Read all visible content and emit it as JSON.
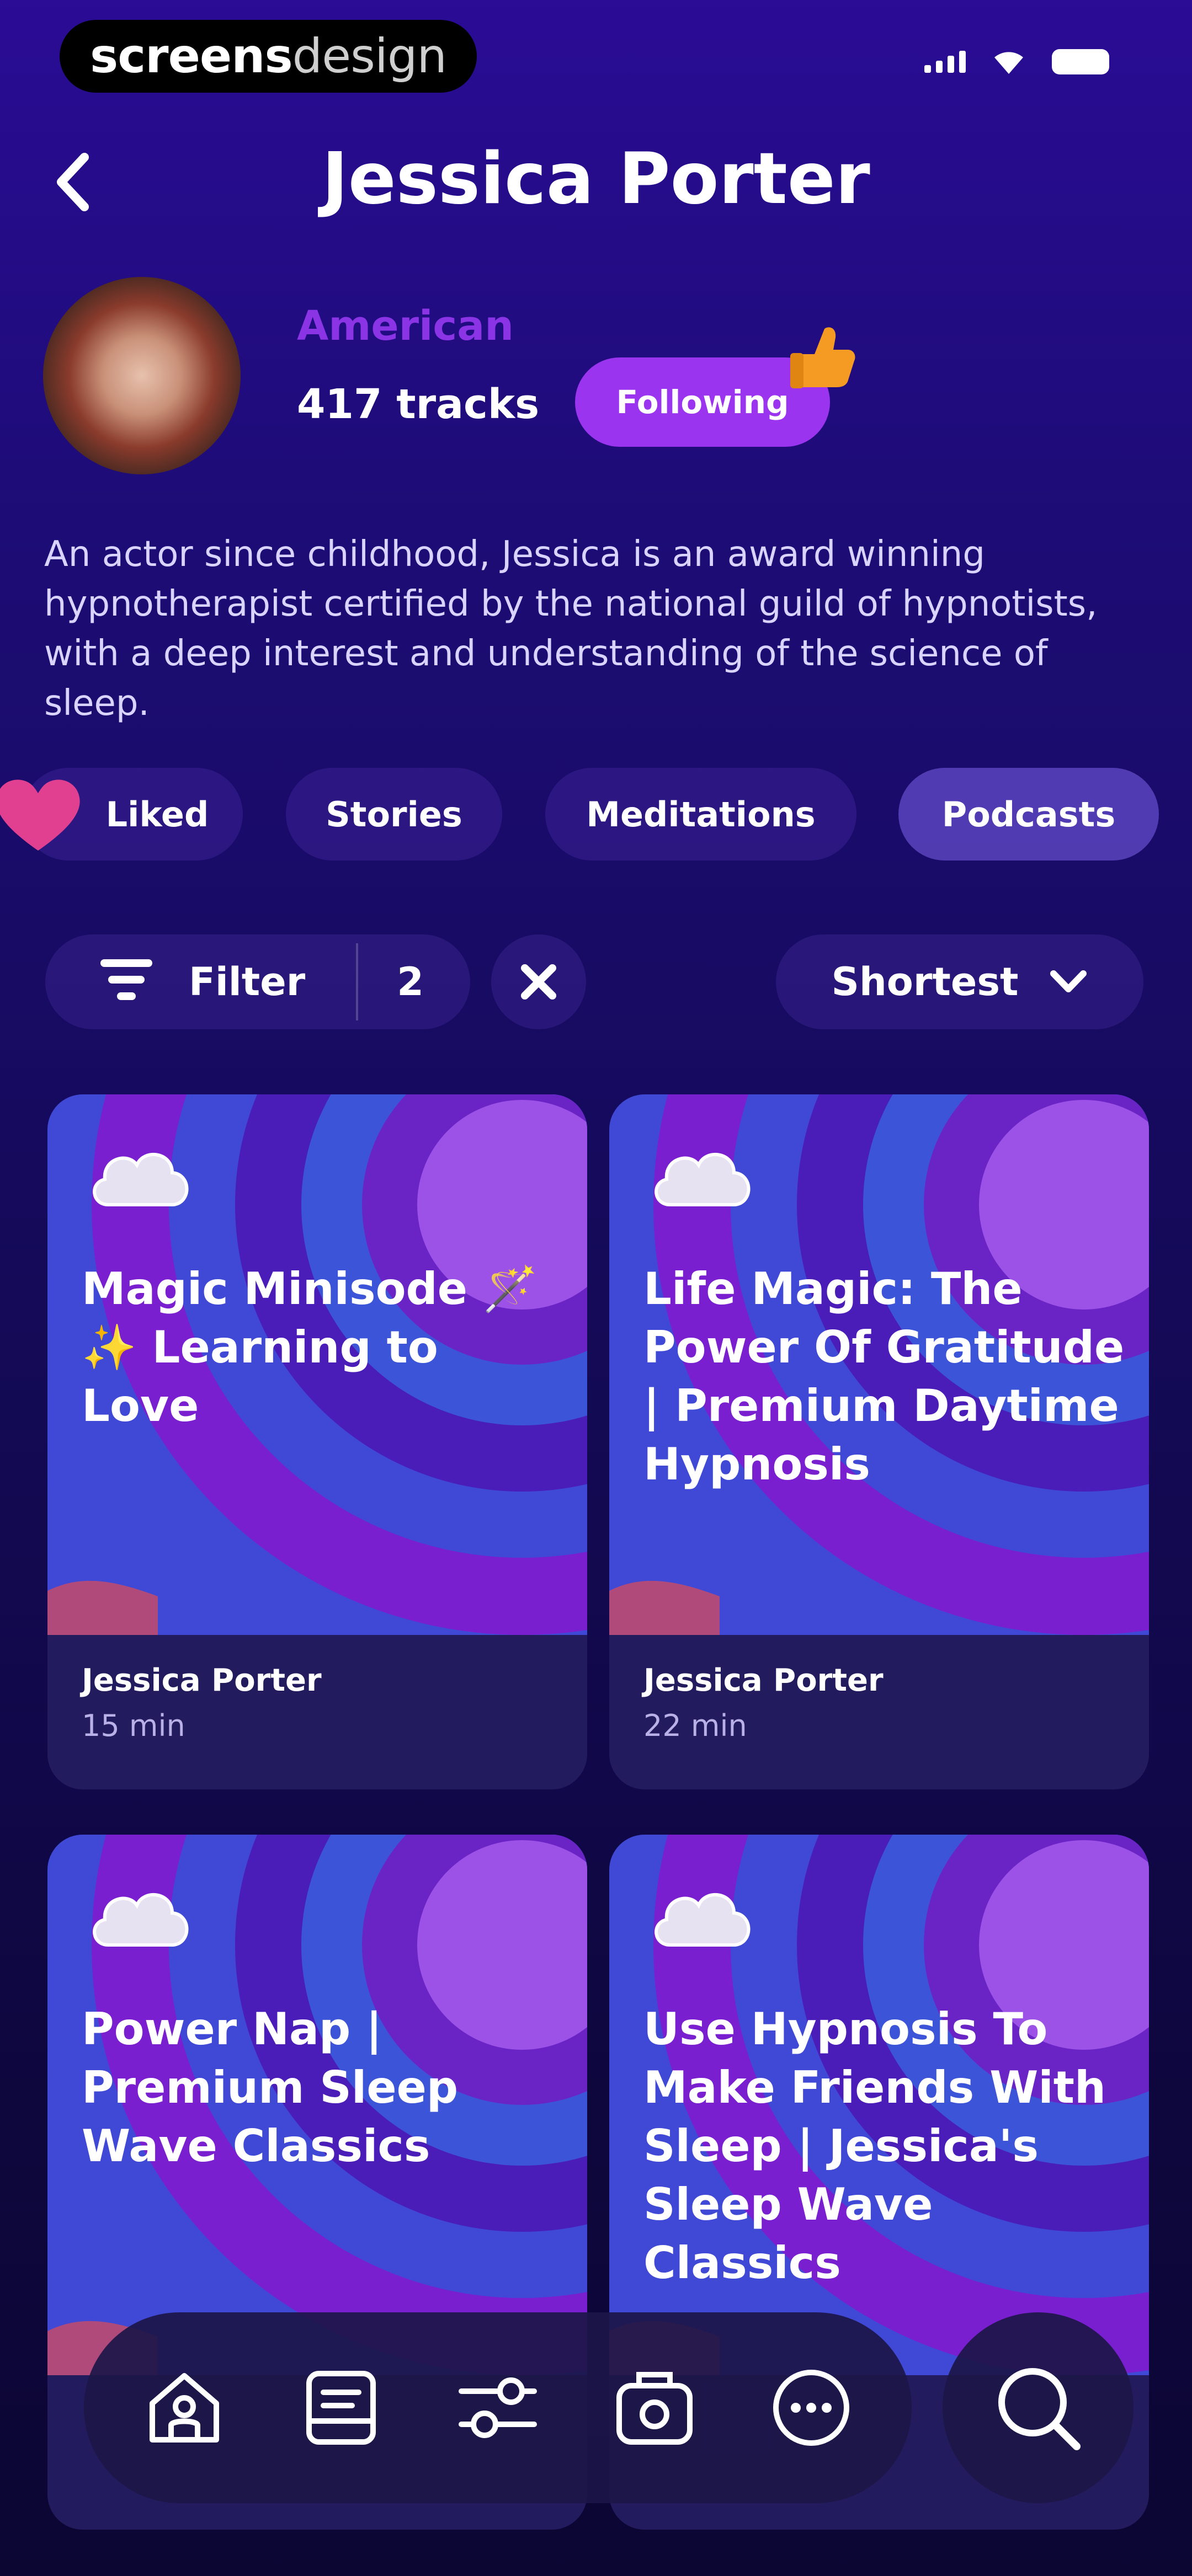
{
  "status_bar": {
    "brand_part1": "screens",
    "brand_part2": "design"
  },
  "header": {
    "title": "Jessica Porter"
  },
  "profile": {
    "nationality": "American",
    "tracks": "417 tracks",
    "follow_label": "Following",
    "bio": "An actor since childhood, Jessica is an award winning hypnotherapist certified by the national guild of hypnotists, with a deep interest and understanding of the science of sleep."
  },
  "categories": [
    {
      "label": "Liked",
      "icon": "heart-icon",
      "active": false
    },
    {
      "label": "Stories",
      "active": false
    },
    {
      "label": "Meditations",
      "active": false
    },
    {
      "label": "Podcasts",
      "active": true
    }
  ],
  "filter": {
    "label": "Filter",
    "count": "2",
    "sort_label": "Shortest"
  },
  "cards": [
    {
      "title": "Magic Minisode 🪄 ✨ Learning to Love",
      "author": "Jessica Porter",
      "duration": "15 min"
    },
    {
      "title": "Life Magic: The Power Of Gratitude | Premium Daytime Hypnosis",
      "author": "Jessica Porter",
      "duration": "22 min"
    },
    {
      "title": "Power Nap | Premium Sleep Wave Classics",
      "author": "",
      "duration": ""
    },
    {
      "title": "Use Hypnosis To Make Friends With Sleep | Jessica's Sleep Wave Classics",
      "author": "",
      "duration": ""
    }
  ],
  "nav": {
    "items": [
      "home-icon",
      "library-icon",
      "adjust-icon",
      "radio-icon",
      "more-icon"
    ],
    "search_icon": "search-icon"
  },
  "colors": {
    "accent": "#9a34ef",
    "nationality": "#8b34e6",
    "background_top": "#2a0c95",
    "card_bg": "#221c5e"
  }
}
